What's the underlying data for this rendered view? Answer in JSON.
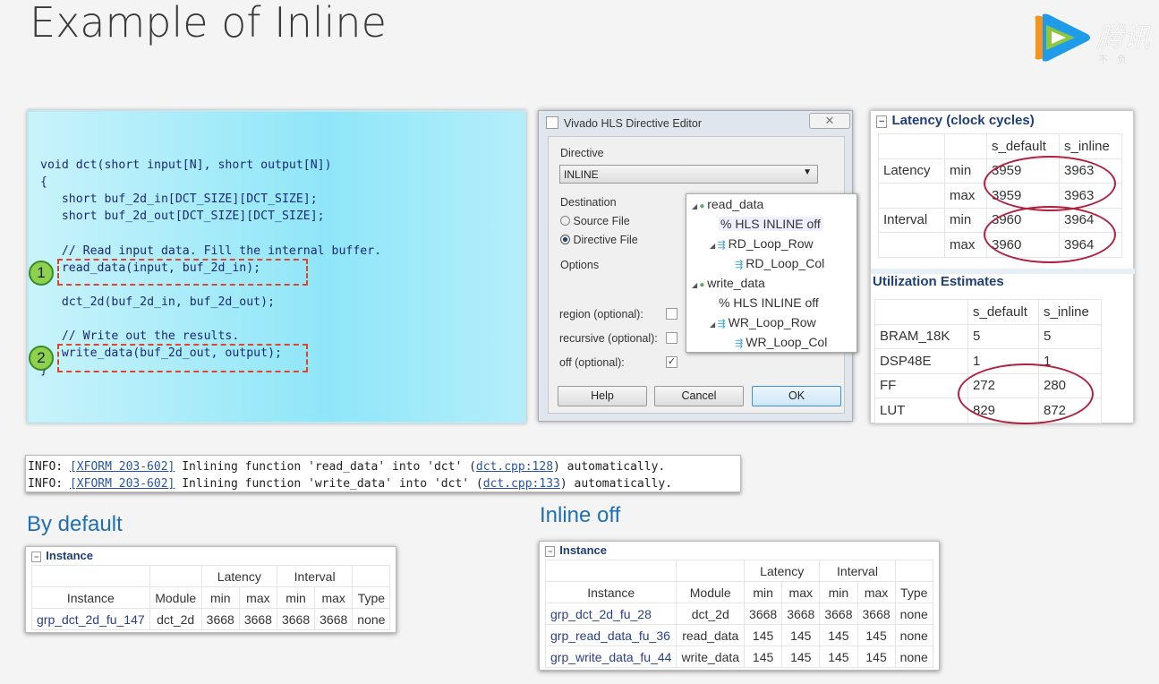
{
  "title": "Example of Inline",
  "logo": {
    "name": "tencent-video-logo",
    "text": "腾讯",
    "slogan": "不负"
  },
  "code": {
    "lines": [
      "void dct(short input[N], short output[N])",
      "{",
      "   short buf_2d_in[DCT_SIZE][DCT_SIZE];",
      "   short buf_2d_out[DCT_SIZE][DCT_SIZE];",
      "",
      "   // Read input data. Fill the internal buffer.",
      "   read_data(input, buf_2d_in);",
      "",
      "   dct_2d(buf_2d_in, buf_2d_out);",
      "",
      "   // Write out the results.",
      "   write_data(buf_2d_out, output);",
      "}"
    ],
    "markers": [
      "1",
      "2"
    ]
  },
  "dialog": {
    "title": "Vivado HLS Directive Editor",
    "directive_label": "Directive",
    "directive_value": "INLINE",
    "destination_label": "Destination",
    "source_file": "Source File",
    "directive_file": "Directive File",
    "destination_selected": "Directive File",
    "options_label": "Options",
    "region": "region (optional):",
    "recursive": "recursive (optional):",
    "off": "off (optional):",
    "region_checked": false,
    "recursive_checked": false,
    "off_checked": true,
    "help": "Help",
    "cancel": "Cancel",
    "ok": "OK"
  },
  "tree": [
    "read_data",
    "% HLS INLINE off",
    "RD_Loop_Row",
    "RD_Loop_Col",
    "write_data",
    "% HLS INLINE off",
    "WR_Loop_Row",
    "WR_Loop_Col"
  ],
  "latency": {
    "title": "Latency (clock cycles)",
    "cols": [
      "s_default",
      "s_inline"
    ],
    "rows": [
      [
        "Latency",
        "min",
        "3959",
        "3963"
      ],
      [
        "",
        "max",
        "3959",
        "3963"
      ],
      [
        "Interval",
        "min",
        "3960",
        "3964"
      ],
      [
        "",
        "max",
        "3960",
        "3964"
      ]
    ]
  },
  "util": {
    "title": "Utilization Estimates",
    "cols": [
      "s_default",
      "s_inline"
    ],
    "rows": [
      [
        "BRAM_18K",
        "5",
        "5"
      ],
      [
        "DSP48E",
        "1",
        "1"
      ],
      [
        "FF",
        "272",
        "280"
      ],
      [
        "LUT",
        "829",
        "872"
      ]
    ]
  },
  "info": [
    {
      "pre": "INFO: ",
      "link": "[XFORM 203-602]",
      "mid": " Inlining function 'read_data' into 'dct' (",
      "file": "dct.cpp:128",
      "post": ") automatically."
    },
    {
      "pre": "INFO: ",
      "link": "[XFORM 203-602]",
      "mid": " Inlining function 'write_data' into 'dct' (",
      "file": "dct.cpp:133",
      "post": ") automatically."
    }
  ],
  "by_default": {
    "title": "By default",
    "section": "Instance",
    "h1": [
      "Latency",
      "Interval"
    ],
    "h2": [
      "Instance",
      "Module",
      "min",
      "max",
      "min",
      "max",
      "Type"
    ],
    "rows": [
      [
        "grp_dct_2d_fu_147",
        "dct_2d",
        "3668",
        "3668",
        "3668",
        "3668",
        "none"
      ]
    ]
  },
  "inline_off": {
    "title": "Inline off",
    "section": "Instance",
    "h1": [
      "Latency",
      "Interval"
    ],
    "h2": [
      "Instance",
      "Module",
      "min",
      "max",
      "min",
      "max",
      "Type"
    ],
    "rows": [
      [
        "grp_dct_2d_fu_28",
        "dct_2d",
        "3668",
        "3668",
        "3668",
        "3668",
        "none"
      ],
      [
        "grp_read_data_fu_36",
        "read_data",
        "145",
        "145",
        "145",
        "145",
        "none"
      ],
      [
        "grp_write_data_fu_44",
        "write_data",
        "145",
        "145",
        "145",
        "145",
        "none"
      ]
    ]
  }
}
